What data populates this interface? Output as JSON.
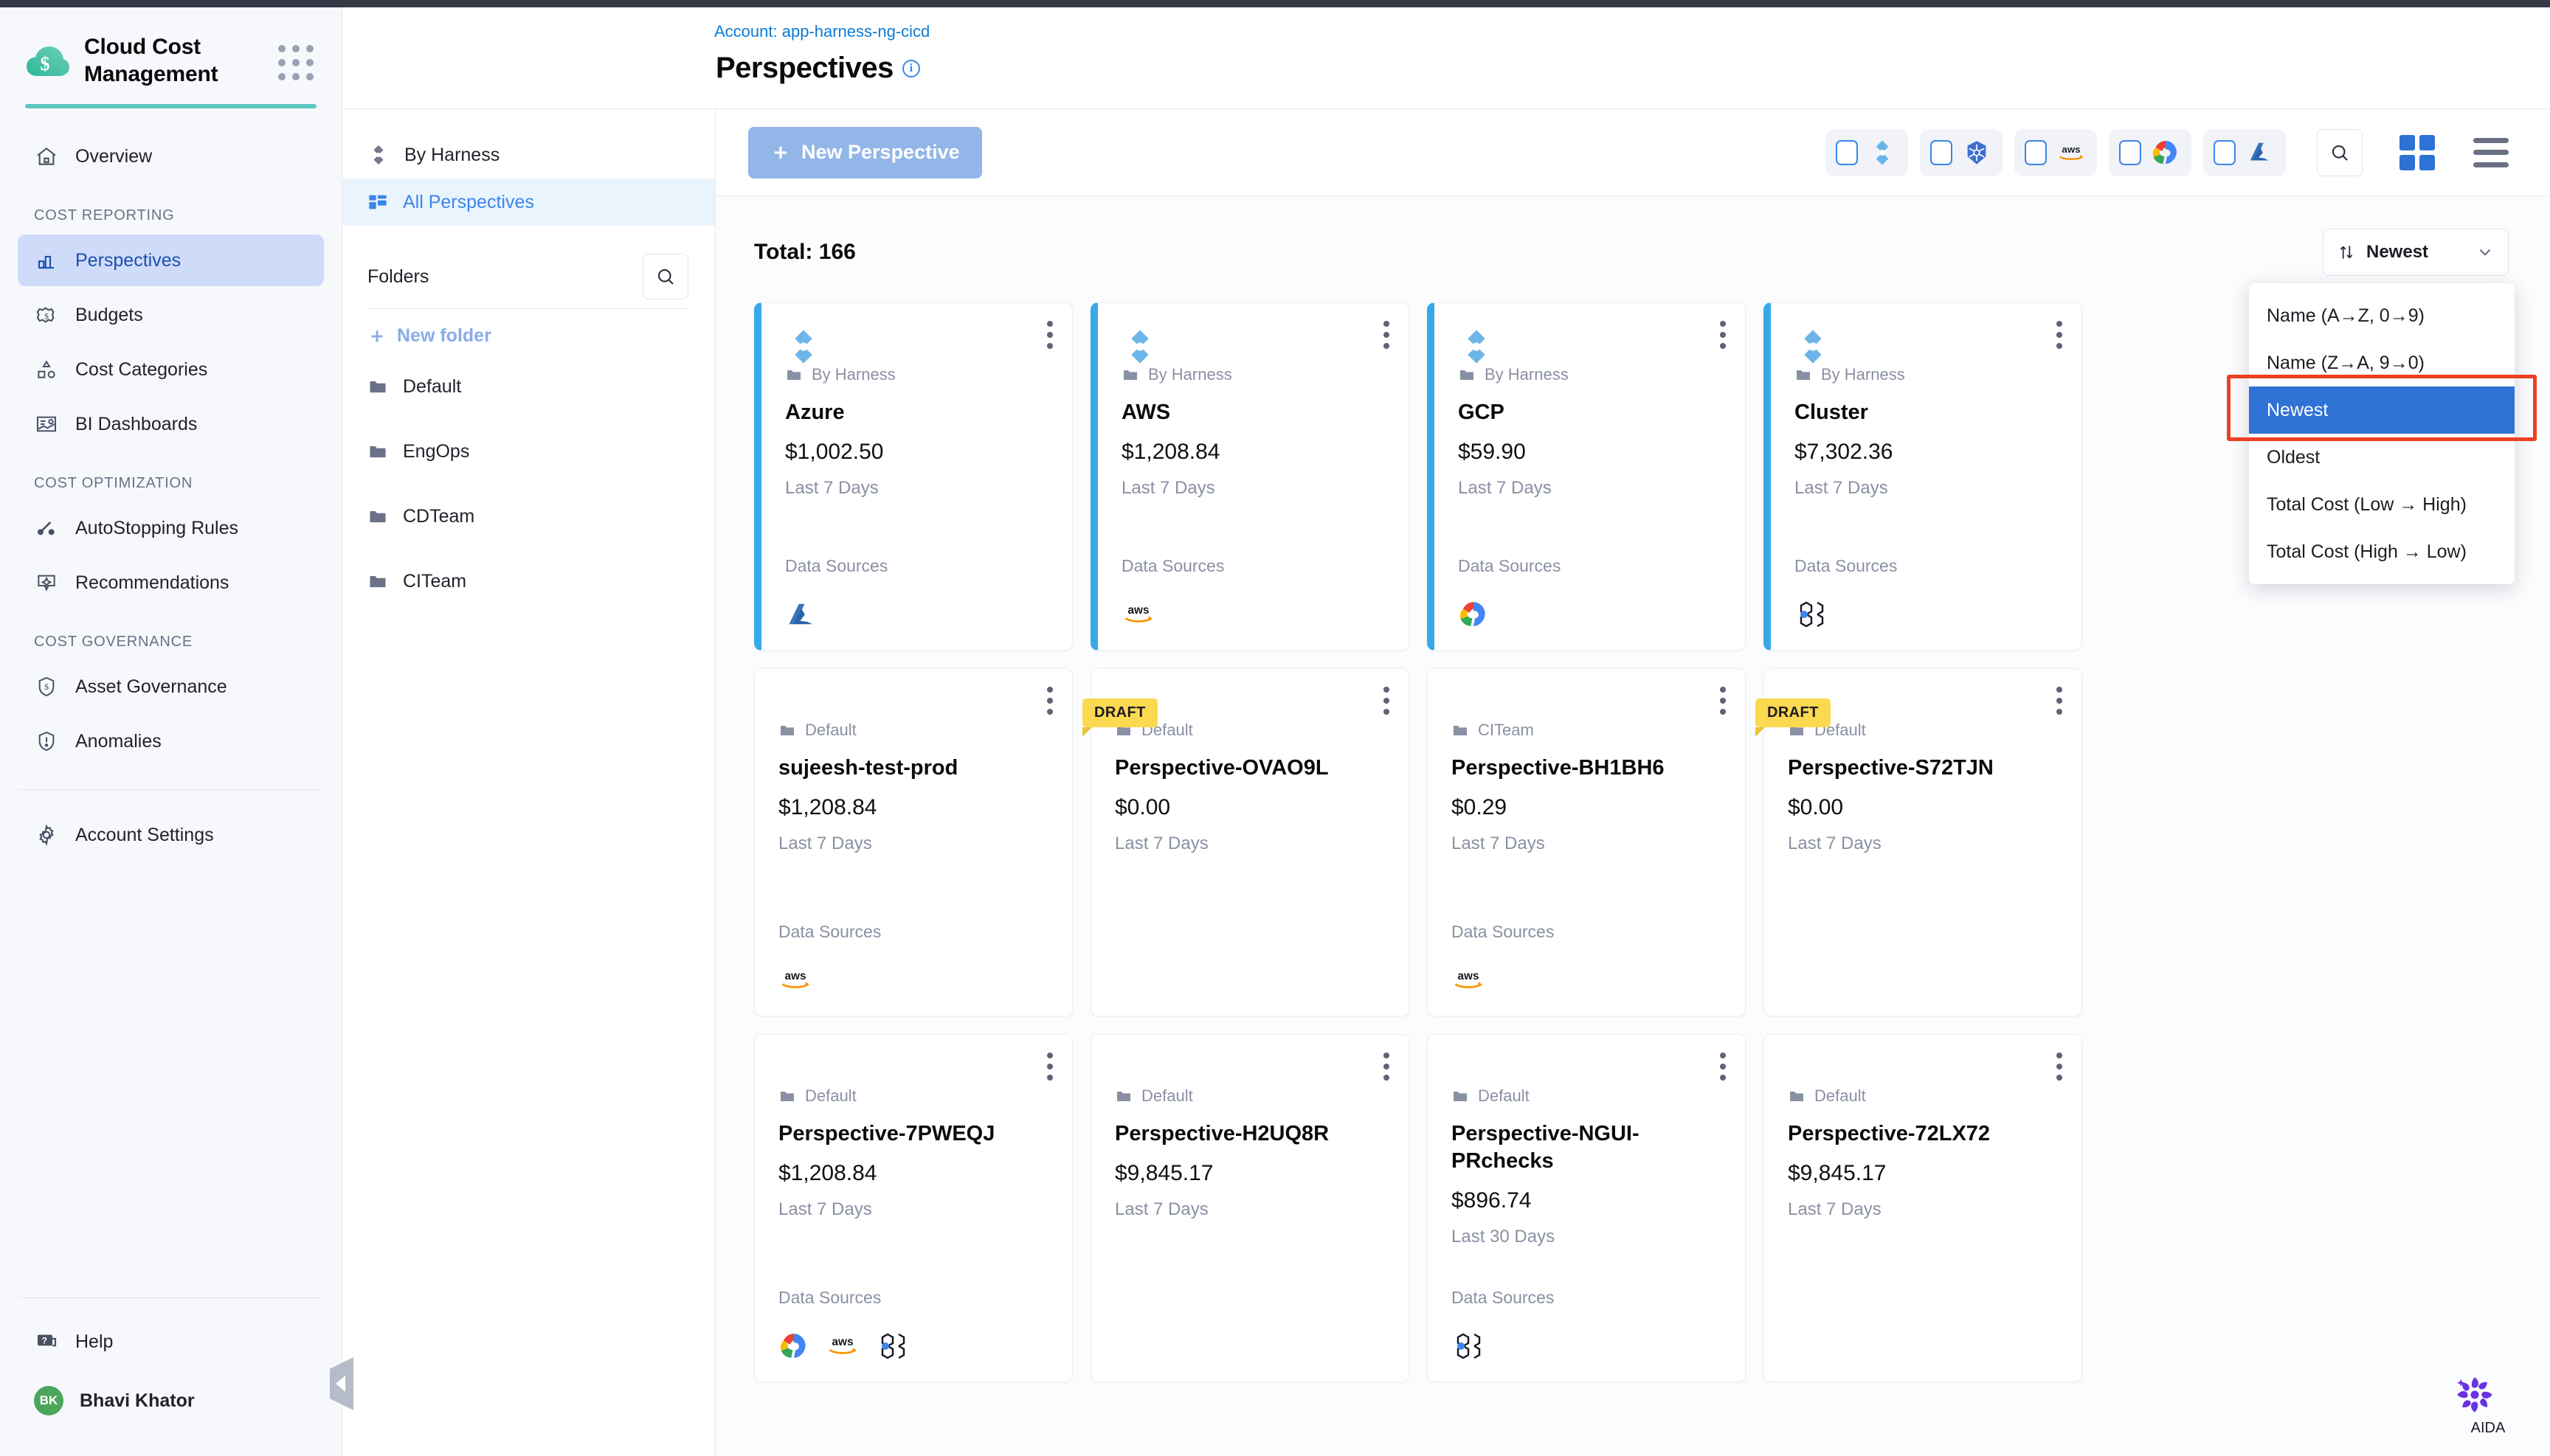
{
  "brand": {
    "title": "Cloud Cost Management",
    "logo_icon": "cloud-dollar-icon",
    "apps_icon": "app-grid-icon"
  },
  "sidebar": {
    "top_items": [
      {
        "label": "Overview",
        "icon": "home-icon"
      }
    ],
    "sections": [
      {
        "title": "COST REPORTING",
        "items": [
          {
            "label": "Perspectives",
            "icon": "bar-chart-icon",
            "active": true
          },
          {
            "label": "Budgets",
            "icon": "budget-icon",
            "active": false
          },
          {
            "label": "Cost Categories",
            "icon": "cost-categories-icon",
            "active": false
          },
          {
            "label": "BI Dashboards",
            "icon": "dashboard-icon",
            "active": false
          }
        ]
      },
      {
        "title": "COST OPTIMIZATION",
        "items": [
          {
            "label": "AutoStopping Rules",
            "icon": "autostopping-icon",
            "active": false
          },
          {
            "label": "Recommendations",
            "icon": "recommendations-icon",
            "active": false
          }
        ]
      },
      {
        "title": "COST GOVERNANCE",
        "items": [
          {
            "label": "Asset Governance",
            "icon": "shield-dollar-icon",
            "active": false
          },
          {
            "label": "Anomalies",
            "icon": "anomaly-icon",
            "active": false
          }
        ]
      }
    ],
    "account_settings": {
      "label": "Account Settings",
      "icon": "gear-icon"
    },
    "help": {
      "label": "Help",
      "icon": "help-chat-icon"
    },
    "user": {
      "name": "Bhavi Khator",
      "initials": "BK",
      "avatar_color": "#4da55c"
    }
  },
  "header": {
    "breadcrumb": "Account: app-harness-ng-cicd",
    "title": "Perspectives",
    "info_icon": "info-circle-icon"
  },
  "folder_panel": {
    "by_harness": {
      "label": "By Harness",
      "icon": "harness-icon"
    },
    "all_perspectives": {
      "label": "All Perspectives",
      "icon": "grid-icon",
      "active": true
    },
    "folders_label": "Folders",
    "search_icon": "search-icon",
    "new_folder_label": "New folder",
    "folders": [
      {
        "label": "Default",
        "icon": "folder-icon"
      },
      {
        "label": "EngOps",
        "icon": "folder-icon"
      },
      {
        "label": "CDTeam",
        "icon": "folder-icon"
      },
      {
        "label": "CITeam",
        "icon": "folder-icon"
      }
    ]
  },
  "toolbar": {
    "new_perspective_label": "New Perspective",
    "filters": [
      {
        "name": "harness",
        "icon": "harness-icon",
        "checked": false
      },
      {
        "name": "kubernetes",
        "icon": "kubernetes-icon",
        "checked": false
      },
      {
        "name": "aws",
        "icon": "aws-icon",
        "checked": false
      },
      {
        "name": "gcp",
        "icon": "gcp-icon",
        "checked": false
      },
      {
        "name": "azure",
        "icon": "azure-icon",
        "checked": false
      }
    ],
    "search_icon": "search-icon",
    "grid_view_icon": "grid-view-icon",
    "list_view_icon": "list-view-icon"
  },
  "list": {
    "total_label": "Total: 166",
    "sort": {
      "selected": "Newest",
      "sort_icon": "sort-arrows-icon",
      "caret_icon": "chevron-down-icon",
      "options": [
        {
          "label": "Name (A→Z, 0→9)",
          "selected": false
        },
        {
          "label": "Name (Z→A, 9→0)",
          "selected": false
        },
        {
          "label": "Newest",
          "selected": true
        },
        {
          "label": "Oldest",
          "selected": false
        },
        {
          "label": "Total Cost (Low → High)",
          "selected": false
        },
        {
          "label": "Total Cost (High → Low)",
          "selected": false
        }
      ],
      "highlight_color": "#ef3f21",
      "selected_bg": "#2f72d6"
    },
    "data_sources_label": "Data Sources",
    "draft_label": "DRAFT",
    "cards": [
      {
        "folder": "By Harness",
        "name": "Azure",
        "cost": "$1,002.50",
        "range": "Last 7 Days",
        "harness": true,
        "draft": false,
        "logo": "harness-icon",
        "sources": [
          "azure"
        ]
      },
      {
        "folder": "By Harness",
        "name": "AWS",
        "cost": "$1,208.84",
        "range": "Last 7 Days",
        "harness": true,
        "draft": false,
        "logo": "harness-icon",
        "sources": [
          "aws"
        ]
      },
      {
        "folder": "By Harness",
        "name": "GCP",
        "cost": "$59.90",
        "range": "Last 7 Days",
        "harness": true,
        "draft": false,
        "logo": "harness-icon",
        "sources": [
          "gcp"
        ]
      },
      {
        "folder": "By Harness",
        "name": "Cluster",
        "cost": "$7,302.36",
        "range": "Last 7 Days",
        "harness": true,
        "draft": false,
        "logo": "harness-icon",
        "sources": [
          "cluster"
        ]
      },
      {
        "folder": "Default",
        "name": "sujeesh-test-prod",
        "cost": "$1,208.84",
        "range": "Last 7 Days",
        "harness": false,
        "draft": false,
        "logo": null,
        "sources": [
          "aws"
        ]
      },
      {
        "folder": "Default",
        "name": "Perspective-OVAO9L",
        "cost": "$0.00",
        "range": "Last 7 Days",
        "harness": false,
        "draft": true,
        "logo": null,
        "sources": []
      },
      {
        "folder": "CITeam",
        "name": "Perspective-BH1BH6",
        "cost": "$0.29",
        "range": "Last 7 Days",
        "harness": false,
        "draft": false,
        "logo": null,
        "sources": [
          "aws"
        ]
      },
      {
        "folder": "Default",
        "name": "Perspective-S72TJN",
        "cost": "$0.00",
        "range": "Last 7 Days",
        "harness": false,
        "draft": true,
        "logo": null,
        "sources": []
      },
      {
        "folder": "Default",
        "name": "Perspective-7PWEQJ",
        "cost": "$1,208.84",
        "range": "Last 7 Days",
        "harness": false,
        "draft": false,
        "logo": null,
        "sources": [
          "gcp",
          "aws",
          "cluster"
        ]
      },
      {
        "folder": "Default",
        "name": "Perspective-H2UQ8R",
        "cost": "$9,845.17",
        "range": "Last 7 Days",
        "harness": false,
        "draft": false,
        "logo": null,
        "sources": []
      },
      {
        "folder": "Default",
        "name": "Perspective-NGUI-PRchecks",
        "cost": "$896.74",
        "range": "Last 30 Days",
        "harness": false,
        "draft": false,
        "logo": null,
        "sources": [
          "cluster"
        ]
      },
      {
        "folder": "Default",
        "name": "Perspective-72LX72",
        "cost": "$9,845.17",
        "range": "Last 7 Days",
        "harness": false,
        "draft": false,
        "logo": null,
        "sources": []
      }
    ]
  },
  "aida": {
    "label": "AIDA",
    "icon": "aida-icon",
    "color": "#6933e0"
  }
}
